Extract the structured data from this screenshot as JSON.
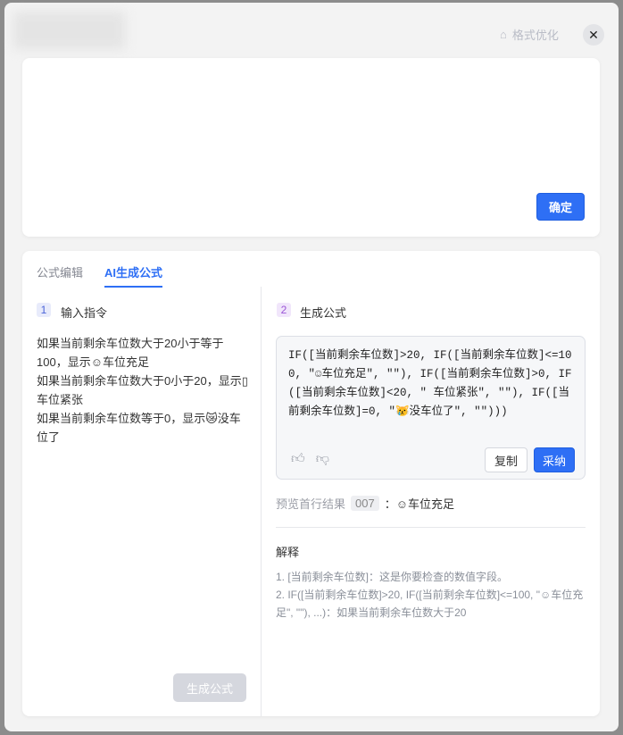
{
  "header": {
    "format_label": "格式优化",
    "format_icon": "format-icon",
    "close_icon": "close-icon"
  },
  "editor": {
    "confirm_label": "确定"
  },
  "tabs": [
    {
      "label": "公式编辑"
    },
    {
      "label": "AI生成公式"
    }
  ],
  "left": {
    "step": "1",
    "title": "输入指令",
    "instruction": "如果当前剩余车位数大于20小于等于100，显示☺车位充足\n如果当前剩余车位数大于0小于20，显示▯车位紧张\n如果当前剩余车位数等于0，显示😿没车位了",
    "generate_label": "生成公式"
  },
  "right": {
    "step": "2",
    "title": "生成公式",
    "formula": "IF([当前剩余车位数]>20, IF([当前剩余车位数]<=100, ″☺车位充足″, ″″), IF([当前剩余车位数]>0, IF([当前剩余车位数]<20, ″  车位紧张″, ″″), IF([当前剩余车位数]=0, ″😿没车位了″, ″″)))",
    "copy_label": "复制",
    "adopt_label": "采纳",
    "preview_label": "预览首行结果",
    "preview_row": "007",
    "preview_result": "：☺车位充足",
    "explain_title": "解释",
    "explanations": [
      "1. [当前剩余车位数]：这是你要检查的数值字段。",
      "2. IF([当前剩余车位数]>20, IF([当前剩余车位数]<=100, \"☺车位充足\", \"\"), ...)：如果当前剩余车位数大于20"
    ]
  },
  "colors": {
    "accent": "#2e6ff5",
    "disabled": "#d5d7de"
  }
}
